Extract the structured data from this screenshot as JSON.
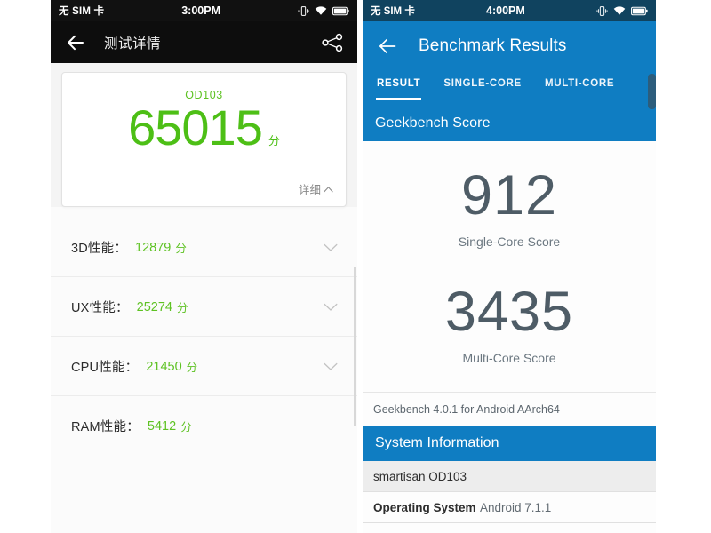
{
  "left_phone": {
    "statusbar": {
      "carrier": "无 SIM 卡",
      "time": "3:00PM",
      "icons": [
        "vibrate-icon",
        "wifi-icon",
        "battery-icon"
      ]
    },
    "appbar": {
      "back": "back-arrow-icon",
      "title": "测试详情",
      "share": "share-icon"
    },
    "score_card": {
      "model": "OD103",
      "score": "65015",
      "unit": "分",
      "detail_label": "详细",
      "detail_caret": "caret-up-icon"
    },
    "rows": [
      {
        "label": "3D性能：",
        "value": "12879",
        "unit": "分",
        "chevron": "chevron-down-icon"
      },
      {
        "label": "UX性能：",
        "value": "25274",
        "unit": "分",
        "chevron": "chevron-down-icon"
      },
      {
        "label": "CPU性能：",
        "value": "21450",
        "unit": "分",
        "chevron": "chevron-down-icon"
      },
      {
        "label": "RAM性能：",
        "value": "5412",
        "unit": "分",
        "chevron": ""
      }
    ],
    "colors": {
      "accent_green": "#4dbf16",
      "row_green": "#5ec223",
      "appbar_bg": "#0d0d0d",
      "statusbar_bg": "#111111"
    }
  },
  "right_phone": {
    "statusbar": {
      "carrier": "无 SIM 卡",
      "time": "4:00PM",
      "icons": [
        "vibrate-icon",
        "wifi-icon",
        "battery-icon"
      ]
    },
    "appbar": {
      "back": "back-arrow-icon",
      "title": "Benchmark Results"
    },
    "tabs": [
      {
        "label": "RESULT",
        "active": true
      },
      {
        "label": "SINGLE-CORE",
        "active": false
      },
      {
        "label": "MULTI-CORE",
        "active": false
      }
    ],
    "score_section_header": "Geekbench Score",
    "scores": [
      {
        "value": "912",
        "label": "Single-Core Score"
      },
      {
        "value": "3435",
        "label": "Multi-Core Score"
      }
    ],
    "footnote": "Geekbench 4.0.1 for Android AArch64",
    "system_section_header": "System Information",
    "system_rows": [
      {
        "key": "smartisan OD103",
        "value": "",
        "bold": false
      },
      {
        "key": "Operating System",
        "value": "Android 7.1.1",
        "bold": true
      }
    ],
    "colors": {
      "brand_blue": "#0f7dc2",
      "statusbar_bg": "#10435f",
      "score_text": "#4e5c66"
    }
  }
}
